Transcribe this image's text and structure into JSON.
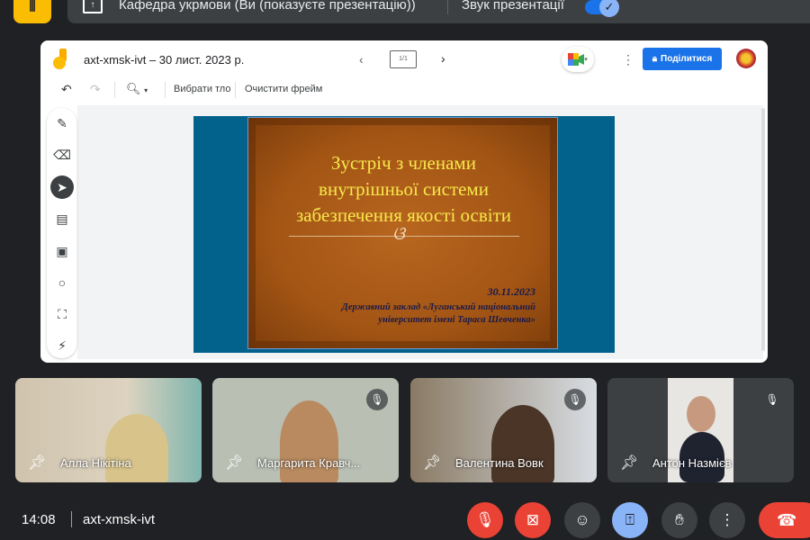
{
  "banner": {
    "presenting_text": "Кафедра укрмови (Ви (показуєте презентацію))",
    "audio_label": "Звук презентації",
    "audio_on": true
  },
  "whiteboard": {
    "title": "axt-xmsk-ivt – 30 лист. 2023 р.",
    "frame_counter": "1/1",
    "share_label": "Поділитися",
    "toolbar": {
      "background_label": "Вибрати тло",
      "clear_label": "Очистити фрейм"
    },
    "tools": [
      "pen",
      "eraser",
      "select",
      "sticky-note",
      "image",
      "circle",
      "text-box",
      "laser"
    ]
  },
  "slide": {
    "title_lines": [
      "Зустріч з членами",
      "внутрішньої системи",
      "забезпечення якості освіти"
    ],
    "ornament": "ଓ",
    "date": "30.11.2023",
    "org_lines": [
      "Державний заклад «Луганський національний",
      "університет імені Тараса Шевченка»"
    ]
  },
  "participants": [
    {
      "name": "Алла Нікітіна",
      "muted": false
    },
    {
      "name": "Маргарита Кравч...",
      "muted": true
    },
    {
      "name": "Валентина Вовк",
      "muted": true
    },
    {
      "name": "Антон Назмієв",
      "muted": true
    }
  ],
  "footer": {
    "time": "14:08",
    "meeting_code": "axt-xmsk-ivt"
  },
  "colors": {
    "accent": "#1a73e8",
    "danger": "#ea4335",
    "slide_bg": "#03628c",
    "slide_brown": "#a35514",
    "title_yellow": "#f7e84a"
  }
}
